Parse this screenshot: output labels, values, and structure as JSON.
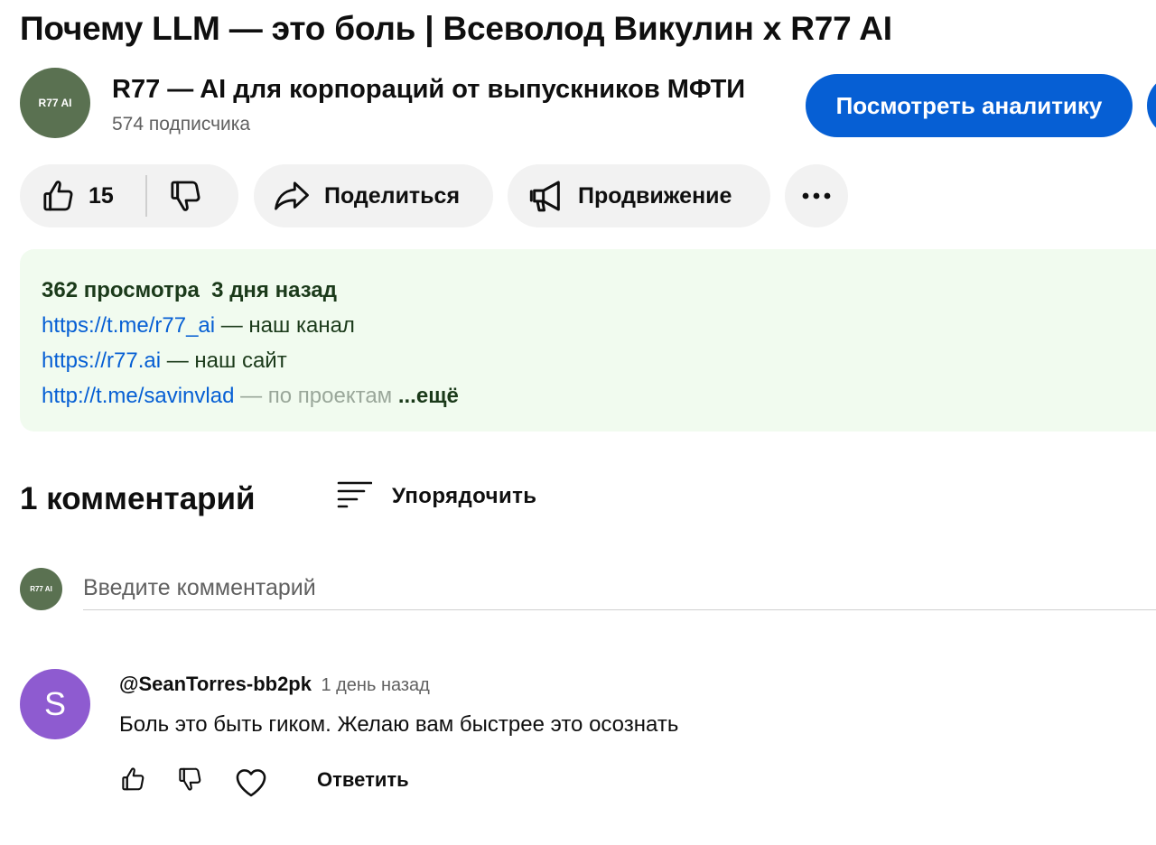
{
  "video": {
    "title": "Почему LLM — это боль | Всеволод Викулин x R77 AI"
  },
  "channel": {
    "avatar_text": "R77 AI",
    "name": "R77 — AI для корпораций от выпускников МФТИ",
    "subscribers": "574 подписчика",
    "analytics_button": "Посмотреть аналитику"
  },
  "actions": {
    "like_count": "15",
    "like_icon": "thumbs-up-icon",
    "dislike_icon": "thumbs-down-icon",
    "share_label": "Поделиться",
    "share_icon": "share-icon",
    "promote_label": "Продвижение",
    "promote_icon": "megaphone-icon",
    "more_icon": "more-horizontal-icon"
  },
  "description": {
    "views": "362 просмотра",
    "date": "3 дня назад",
    "lines": [
      {
        "url": "https://t.me/r77_ai",
        "text": " — наш канал"
      },
      {
        "url": "https://r77.ai",
        "text": " — наш сайт"
      },
      {
        "url": "http://t.me/savinvlad",
        "text": " — по проектам"
      }
    ],
    "more_label": "...ещё"
  },
  "comments": {
    "count_label": "1 комментарий",
    "sort_label": "Упорядочить",
    "sort_icon": "sort-icon",
    "input_placeholder": "Введите комментарий",
    "my_avatar_text": "R77 AI",
    "items": [
      {
        "avatar_letter": "S",
        "author": "@SeanTorres-bb2pk",
        "time": "1 день назад",
        "text": "Боль это быть гиком. Желаю вам быстрее это осознать",
        "reply_label": "Ответить"
      }
    ]
  },
  "colors": {
    "accent": "#065fd4",
    "description_bg": "#f1fbef",
    "channel_avatar_bg": "#5a7151",
    "comment_avatar_bg": "#8e5bd0"
  }
}
